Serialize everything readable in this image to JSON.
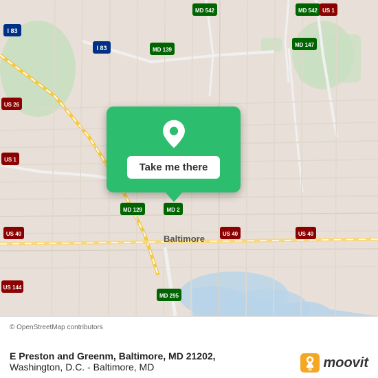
{
  "map": {
    "alt": "Map of Baltimore, MD area"
  },
  "popup": {
    "button_label": "Take me there"
  },
  "footer": {
    "attribution": "© OpenStreetMap contributors",
    "address_line1": "E Preston and Greenm, Baltimore, MD 21202,",
    "address_line2": "Washington, D.C. - Baltimore, MD"
  },
  "moovit": {
    "logo_text": "moovit"
  }
}
